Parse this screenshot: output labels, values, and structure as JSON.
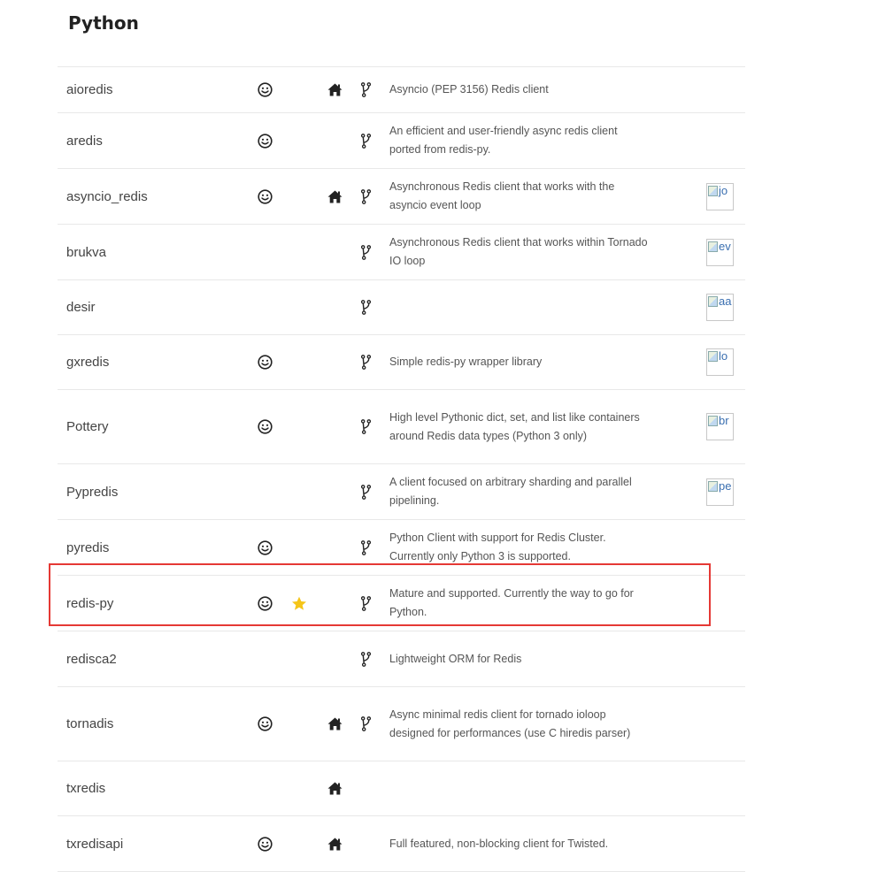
{
  "page": {
    "title": "Python"
  },
  "clients": [
    {
      "name": "aioredis",
      "recommended_icon": true,
      "starred": false,
      "homepage_link": true,
      "repo_link": true,
      "description": "Asyncio (PEP 3156) Redis client",
      "author_image_alt": ""
    },
    {
      "name": "aredis",
      "recommended_icon": true,
      "starred": false,
      "homepage_link": false,
      "repo_link": true,
      "description": "An efficient and user-friendly async redis client ported from redis-py.",
      "author_image_alt": ""
    },
    {
      "name": "asyncio_redis",
      "recommended_icon": true,
      "starred": false,
      "homepage_link": true,
      "repo_link": true,
      "description": "Asynchronous Redis client that works with the asyncio event loop",
      "author_image_alt": "jo"
    },
    {
      "name": "brukva",
      "recommended_icon": false,
      "starred": false,
      "homepage_link": false,
      "repo_link": true,
      "description": "Asynchronous Redis client that works within Tornado IO loop",
      "author_image_alt": "ev"
    },
    {
      "name": "desir",
      "recommended_icon": false,
      "starred": false,
      "homepage_link": false,
      "repo_link": true,
      "description": "",
      "author_image_alt": "aa"
    },
    {
      "name": "gxredis",
      "recommended_icon": true,
      "starred": false,
      "homepage_link": false,
      "repo_link": true,
      "description": "Simple redis-py wrapper library",
      "author_image_alt": "lo"
    },
    {
      "name": "Pottery",
      "recommended_icon": true,
      "starred": false,
      "homepage_link": false,
      "repo_link": true,
      "description": "High level Pythonic dict, set, and list like containers around Redis data types (Python 3 only)",
      "author_image_alt": "br"
    },
    {
      "name": "Pypredis",
      "recommended_icon": false,
      "starred": false,
      "homepage_link": false,
      "repo_link": true,
      "description": "A client focused on arbitrary sharding and parallel pipelining.",
      "author_image_alt": "pe"
    },
    {
      "name": "pyredis",
      "recommended_icon": true,
      "starred": false,
      "homepage_link": false,
      "repo_link": true,
      "description": "Python Client with support for Redis Cluster. Currently only Python 3 is supported.",
      "author_image_alt": ""
    },
    {
      "name": "redis-py",
      "recommended_icon": true,
      "starred": true,
      "homepage_link": false,
      "repo_link": true,
      "description": "Mature and supported. Currently the way to go for Python.",
      "author_image_alt": ""
    },
    {
      "name": "redisca2",
      "recommended_icon": false,
      "starred": false,
      "homepage_link": false,
      "repo_link": true,
      "description": "Lightweight ORM for Redis",
      "author_image_alt": ""
    },
    {
      "name": "tornadis",
      "recommended_icon": true,
      "starred": false,
      "homepage_link": true,
      "repo_link": true,
      "description": "Async minimal redis client for tornado ioloop designed for performances (use C hiredis parser)",
      "author_image_alt": ""
    },
    {
      "name": "txredis",
      "recommended_icon": false,
      "starred": false,
      "homepage_link": true,
      "repo_link": false,
      "description": "",
      "author_image_alt": ""
    },
    {
      "name": "txredisapi",
      "recommended_icon": true,
      "starred": false,
      "homepage_link": true,
      "repo_link": false,
      "description": "Full featured, non-blocking client for Twisted.",
      "author_image_alt": ""
    }
  ],
  "colors": {
    "highlight_border": "#e53935",
    "star": "#f5c518",
    "icon": "#222222",
    "row_divider": "#e8e8e8"
  },
  "icons": {
    "recommended": "smiley-icon",
    "starred": "star-icon",
    "homepage": "home-icon",
    "repository": "code-fork-icon",
    "author": "broken-image-icon"
  }
}
